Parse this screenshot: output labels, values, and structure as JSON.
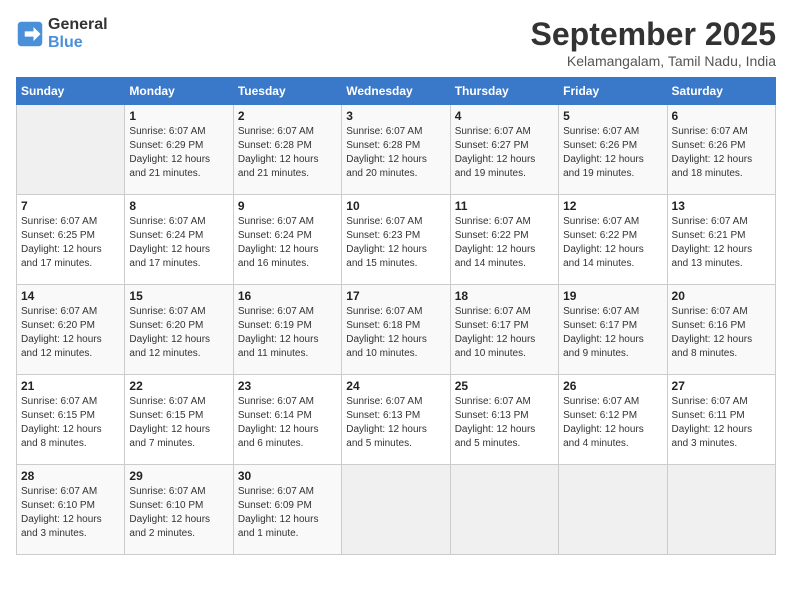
{
  "logo": {
    "line1": "General",
    "line2": "Blue"
  },
  "title": "September 2025",
  "location": "Kelamangalam, Tamil Nadu, India",
  "headers": [
    "Sunday",
    "Monday",
    "Tuesday",
    "Wednesday",
    "Thursday",
    "Friday",
    "Saturday"
  ],
  "weeks": [
    [
      {
        "day": "",
        "info": ""
      },
      {
        "day": "1",
        "info": "Sunrise: 6:07 AM\nSunset: 6:29 PM\nDaylight: 12 hours\nand 21 minutes."
      },
      {
        "day": "2",
        "info": "Sunrise: 6:07 AM\nSunset: 6:28 PM\nDaylight: 12 hours\nand 21 minutes."
      },
      {
        "day": "3",
        "info": "Sunrise: 6:07 AM\nSunset: 6:28 PM\nDaylight: 12 hours\nand 20 minutes."
      },
      {
        "day": "4",
        "info": "Sunrise: 6:07 AM\nSunset: 6:27 PM\nDaylight: 12 hours\nand 19 minutes."
      },
      {
        "day": "5",
        "info": "Sunrise: 6:07 AM\nSunset: 6:26 PM\nDaylight: 12 hours\nand 19 minutes."
      },
      {
        "day": "6",
        "info": "Sunrise: 6:07 AM\nSunset: 6:26 PM\nDaylight: 12 hours\nand 18 minutes."
      }
    ],
    [
      {
        "day": "7",
        "info": "Sunrise: 6:07 AM\nSunset: 6:25 PM\nDaylight: 12 hours\nand 17 minutes."
      },
      {
        "day": "8",
        "info": "Sunrise: 6:07 AM\nSunset: 6:24 PM\nDaylight: 12 hours\nand 17 minutes."
      },
      {
        "day": "9",
        "info": "Sunrise: 6:07 AM\nSunset: 6:24 PM\nDaylight: 12 hours\nand 16 minutes."
      },
      {
        "day": "10",
        "info": "Sunrise: 6:07 AM\nSunset: 6:23 PM\nDaylight: 12 hours\nand 15 minutes."
      },
      {
        "day": "11",
        "info": "Sunrise: 6:07 AM\nSunset: 6:22 PM\nDaylight: 12 hours\nand 14 minutes."
      },
      {
        "day": "12",
        "info": "Sunrise: 6:07 AM\nSunset: 6:22 PM\nDaylight: 12 hours\nand 14 minutes."
      },
      {
        "day": "13",
        "info": "Sunrise: 6:07 AM\nSunset: 6:21 PM\nDaylight: 12 hours\nand 13 minutes."
      }
    ],
    [
      {
        "day": "14",
        "info": "Sunrise: 6:07 AM\nSunset: 6:20 PM\nDaylight: 12 hours\nand 12 minutes."
      },
      {
        "day": "15",
        "info": "Sunrise: 6:07 AM\nSunset: 6:20 PM\nDaylight: 12 hours\nand 12 minutes."
      },
      {
        "day": "16",
        "info": "Sunrise: 6:07 AM\nSunset: 6:19 PM\nDaylight: 12 hours\nand 11 minutes."
      },
      {
        "day": "17",
        "info": "Sunrise: 6:07 AM\nSunset: 6:18 PM\nDaylight: 12 hours\nand 10 minutes."
      },
      {
        "day": "18",
        "info": "Sunrise: 6:07 AM\nSunset: 6:17 PM\nDaylight: 12 hours\nand 10 minutes."
      },
      {
        "day": "19",
        "info": "Sunrise: 6:07 AM\nSunset: 6:17 PM\nDaylight: 12 hours\nand 9 minutes."
      },
      {
        "day": "20",
        "info": "Sunrise: 6:07 AM\nSunset: 6:16 PM\nDaylight: 12 hours\nand 8 minutes."
      }
    ],
    [
      {
        "day": "21",
        "info": "Sunrise: 6:07 AM\nSunset: 6:15 PM\nDaylight: 12 hours\nand 8 minutes."
      },
      {
        "day": "22",
        "info": "Sunrise: 6:07 AM\nSunset: 6:15 PM\nDaylight: 12 hours\nand 7 minutes."
      },
      {
        "day": "23",
        "info": "Sunrise: 6:07 AM\nSunset: 6:14 PM\nDaylight: 12 hours\nand 6 minutes."
      },
      {
        "day": "24",
        "info": "Sunrise: 6:07 AM\nSunset: 6:13 PM\nDaylight: 12 hours\nand 5 minutes."
      },
      {
        "day": "25",
        "info": "Sunrise: 6:07 AM\nSunset: 6:13 PM\nDaylight: 12 hours\nand 5 minutes."
      },
      {
        "day": "26",
        "info": "Sunrise: 6:07 AM\nSunset: 6:12 PM\nDaylight: 12 hours\nand 4 minutes."
      },
      {
        "day": "27",
        "info": "Sunrise: 6:07 AM\nSunset: 6:11 PM\nDaylight: 12 hours\nand 3 minutes."
      }
    ],
    [
      {
        "day": "28",
        "info": "Sunrise: 6:07 AM\nSunset: 6:10 PM\nDaylight: 12 hours\nand 3 minutes."
      },
      {
        "day": "29",
        "info": "Sunrise: 6:07 AM\nSunset: 6:10 PM\nDaylight: 12 hours\nand 2 minutes."
      },
      {
        "day": "30",
        "info": "Sunrise: 6:07 AM\nSunset: 6:09 PM\nDaylight: 12 hours\nand 1 minute."
      },
      {
        "day": "",
        "info": ""
      },
      {
        "day": "",
        "info": ""
      },
      {
        "day": "",
        "info": ""
      },
      {
        "day": "",
        "info": ""
      }
    ]
  ]
}
